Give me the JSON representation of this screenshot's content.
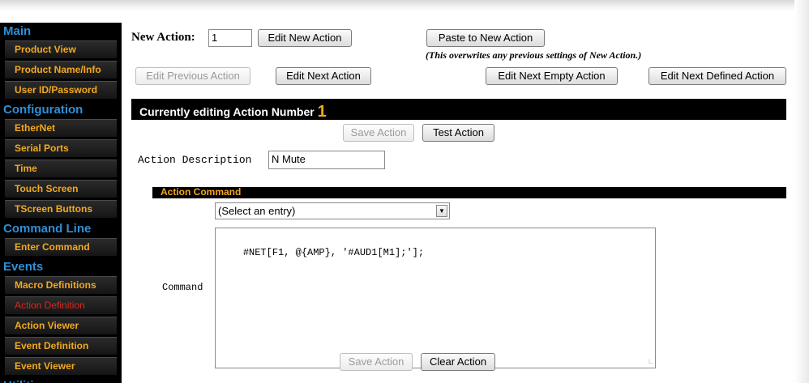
{
  "sidebar": {
    "sections": [
      {
        "title": "Main",
        "items": [
          "Product View",
          "Product Name/Info",
          "User ID/Password"
        ]
      },
      {
        "title": "Configuration",
        "items": [
          "EtherNet",
          "Serial Ports",
          "Time",
          "Touch Screen",
          "TScreen Buttons"
        ]
      },
      {
        "title": "Command Line",
        "items": [
          "Enter Command"
        ]
      },
      {
        "title": "Events",
        "items": [
          "Macro Definitions",
          "Action Definition",
          "Action Viewer",
          "Event Definition",
          "Event Viewer"
        ]
      },
      {
        "title": "Utilities",
        "items": []
      }
    ],
    "active_item": "Action Definition"
  },
  "toolbar": {
    "new_action_label": "New Action:",
    "new_action_value": "1",
    "edit_new_action": "Edit New Action",
    "paste_to_new_action": "Paste to New Action",
    "paste_note": "(This overwrites any previous settings of New Action.)",
    "edit_previous_action": "Edit Previous Action",
    "edit_next_action": "Edit Next Action",
    "edit_next_empty_action": "Edit Next Empty Action",
    "edit_next_defined_action": "Edit Next Defined Action"
  },
  "editing": {
    "heading": "Currently editing Action Number",
    "number": "1"
  },
  "form": {
    "save_action": "Save Action",
    "test_action": "Test Action",
    "description_label": "Action Description",
    "description_value": "N Mute",
    "command_section_title": "Action Command",
    "select_value": "(Select an entry)",
    "command_label": "Command",
    "command_value": "#NET[F1, @{AMP}, '#AUD1[M1];'];",
    "clear_action": "Clear Action"
  },
  "colors": {
    "sidebar_bg": "#000000",
    "section_title": "#2f8fd8",
    "item_text": "#f2a91f",
    "active_item": "#e0261b"
  }
}
